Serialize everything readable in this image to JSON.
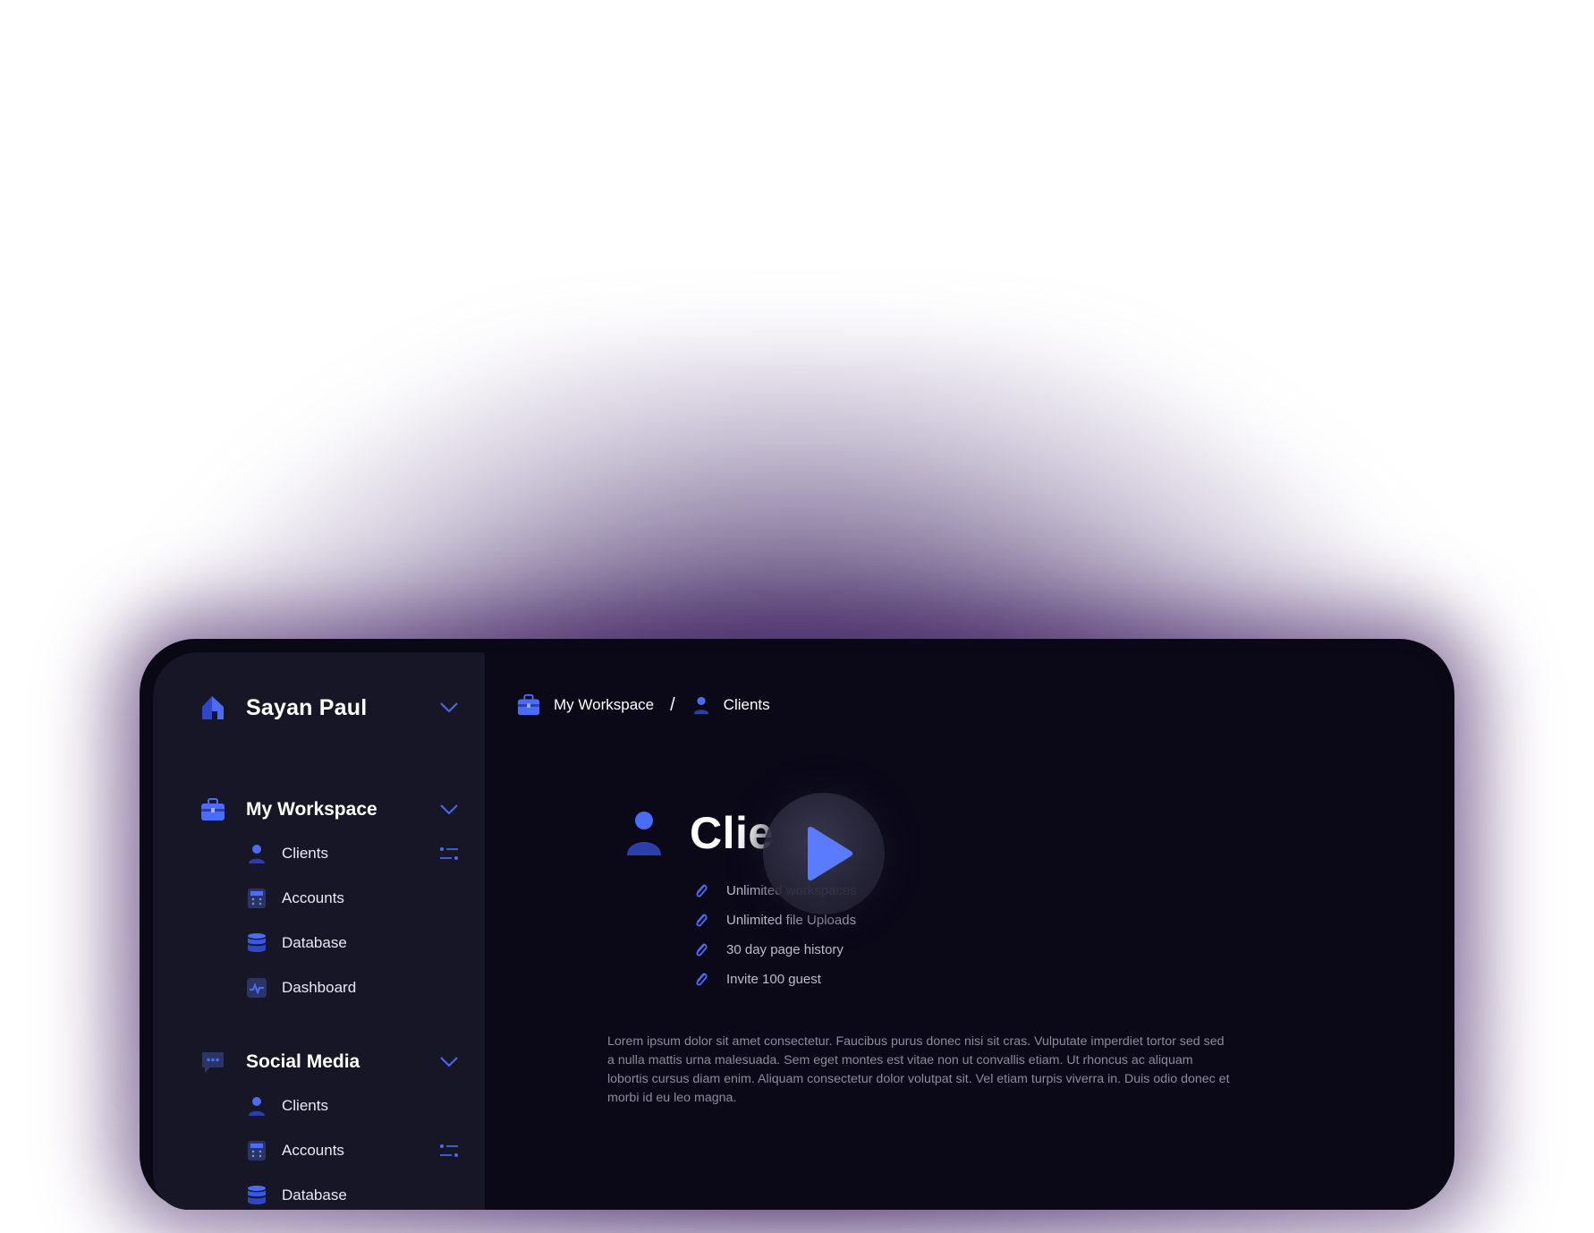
{
  "user": {
    "name": "Sayan Paul"
  },
  "sidebar": {
    "sections": [
      {
        "title": "My Workspace",
        "items": [
          {
            "label": "Clients",
            "icon": "user-icon"
          },
          {
            "label": "Accounts",
            "icon": "calculator-icon"
          },
          {
            "label": "Database",
            "icon": "database-icon"
          },
          {
            "label": "Dashboard",
            "icon": "activity-icon"
          }
        ]
      },
      {
        "title": "Social Media",
        "items": [
          {
            "label": "Clients",
            "icon": "user-icon"
          },
          {
            "label": "Accounts",
            "icon": "calculator-icon"
          },
          {
            "label": "Database",
            "icon": "database-icon"
          }
        ]
      }
    ]
  },
  "breadcrumb": {
    "workspace": "My Workspace",
    "separator": "/",
    "current": "Clients"
  },
  "page": {
    "title": "Clients",
    "features": [
      "Unlimited workspaces",
      "Unlimited file Uploads",
      "30 day page history",
      "Invite 100 guest"
    ],
    "description": "Lorem ipsum dolor sit amet consectetur. Faucibus purus donec nisi sit cras. Vulputate imperdiet tortor sed sed a nulla mattis urna malesuada. Sem eget montes est vitae non ut convallis etiam. Ut rhoncus ac aliquam lobortis cursus diam enim. Aliquam consectetur dolor volutpat sit. Vel etiam turpis viverra in. Duis odio donec et morbi id eu leo magna."
  },
  "colors": {
    "accent": "#4b6bfb",
    "sidebar_bg": "#171627",
    "main_bg": "#0b0918"
  }
}
